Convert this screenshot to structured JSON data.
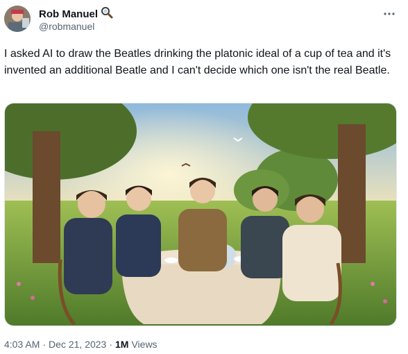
{
  "author": {
    "display_name": "Rob Manuel",
    "handle": "@robmanuel",
    "badge_icon": "magnifier-icon"
  },
  "more_icon": "more-dots-icon",
  "tweet_text": "I asked AI to draw the Beatles drinking the platonic ideal of a cup of tea and it's invented an additional Beatle and I can't decide which one isn't the real Beatle.",
  "meta": {
    "time": "4:03 AM",
    "separator": "·",
    "date": "Dec 21, 2023",
    "views_count": "1M",
    "views_label": "Views"
  },
  "colors": {
    "text": "#0f1419",
    "secondary": "#536471",
    "border": "#e1e8ed"
  }
}
